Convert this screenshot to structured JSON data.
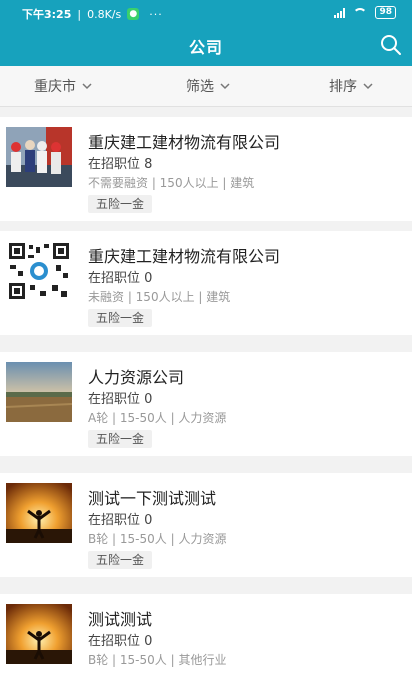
{
  "status_bar": {
    "time": "下午3:25",
    "speed": "0.8K/s",
    "dots": "···",
    "battery": "98"
  },
  "header": {
    "title": "公司"
  },
  "filters": [
    {
      "label": "重庆市"
    },
    {
      "label": "筛选"
    },
    {
      "label": "排序"
    }
  ],
  "companies": [
    {
      "name": "重庆建工建材物流有限公司",
      "jobs": "在招职位  8",
      "meta": "不需要融资 | 150人以上 | 建筑",
      "tag": "五险一金",
      "thumb": "construction-workers-photo"
    },
    {
      "name": "重庆建工建材物流有限公司",
      "jobs": "在招职位  0",
      "meta": "未融资 | 150人以上 | 建筑",
      "tag": "五险一金",
      "thumb": "qr-code"
    },
    {
      "name": "人力资源公司",
      "jobs": "在招职位  0",
      "meta": "A轮 | 15-50人 | 人力资源",
      "tag": "五险一金",
      "thumb": "landscape-photo"
    },
    {
      "name": "测试一下测试测试",
      "jobs": "在招职位  0",
      "meta": "B轮 | 15-50人 | 人力资源",
      "tag": "五险一金",
      "thumb": "sunset-silhouette-photo"
    },
    {
      "name": "测试测试",
      "jobs": "在招职位  0",
      "meta": "B轮 | 15-50人 | 其他行业",
      "tag": "",
      "thumb": "sunset-silhouette-photo"
    }
  ]
}
